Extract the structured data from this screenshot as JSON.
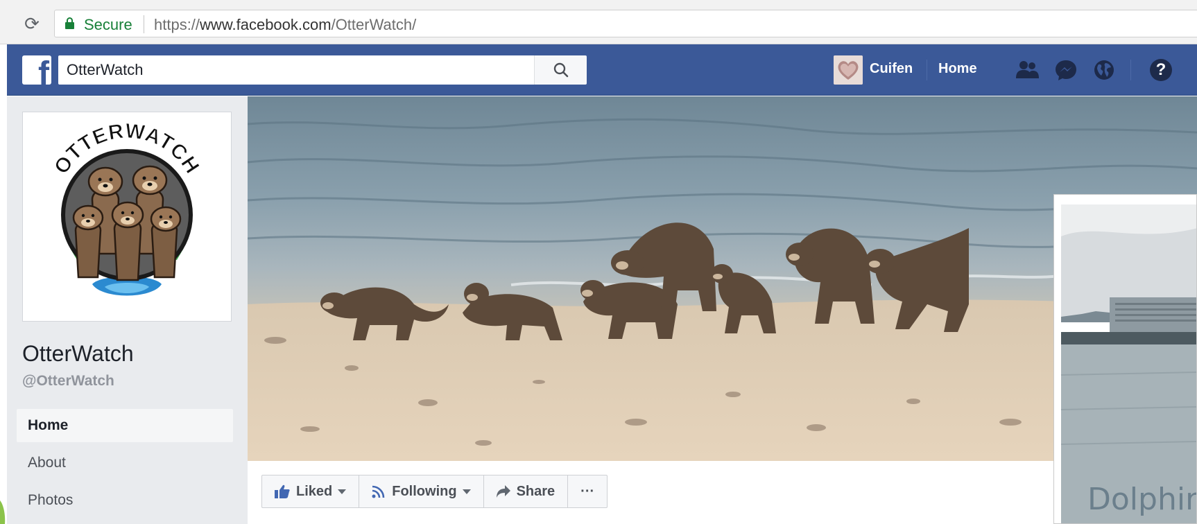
{
  "browser": {
    "secure_label": "Secure",
    "url_scheme": "https://",
    "url_host": "www.facebook.com",
    "url_path": "/OtterWatch/"
  },
  "topbar": {
    "search_value": "OtterWatch",
    "user_name": "Cuifen",
    "home_label": "Home",
    "icons": [
      "facebook-logo-icon",
      "search-icon",
      "friends-icon",
      "messages-icon",
      "notifications-globe-icon",
      "help-icon"
    ],
    "brand_color": "#3b5998"
  },
  "page": {
    "logo_text": "OTTERWATCH",
    "name": "OtterWatch",
    "handle": "@OtterWatch"
  },
  "sidebar": {
    "items": [
      {
        "label": "Home",
        "active": true
      },
      {
        "label": "About",
        "active": false
      },
      {
        "label": "Photos",
        "active": false
      }
    ]
  },
  "actions": {
    "liked": "Liked",
    "following": "Following",
    "share": "Share",
    "more": "···"
  },
  "video": {
    "caption": "Dolphin"
  }
}
